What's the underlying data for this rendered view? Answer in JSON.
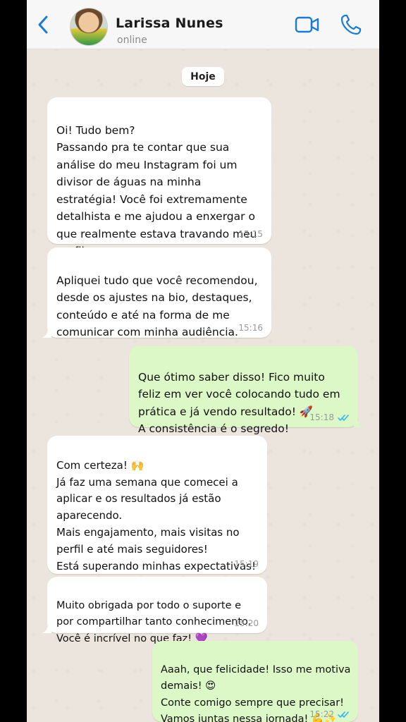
{
  "header": {
    "contact_name": "Larissa Nunes",
    "status": "online",
    "accent_color": "#1a7bd6",
    "icons": [
      "back-chevron-icon",
      "video-camera-icon",
      "phone-icon"
    ]
  },
  "chat": {
    "day_label": "Hoje",
    "messages": [
      {
        "direction": "in",
        "text": "Oi! Tudo bem?\nPassando pra te contar que sua análise do meu Instagram foi um divisor de águas na minha estratégia! Você foi extremamente detalhista e me ajudou a enxergar o que realmente estava travando meu perfil.",
        "time": "15:15"
      },
      {
        "direction": "in",
        "text": "Apliquei tudo que você recomendou, desde os ajustes na bio, destaques, conteúdo e até na forma de me comunicar com minha audiência.",
        "time": "15:16"
      },
      {
        "direction": "out",
        "text": "Que ótimo saber disso! Fico muito feliz em ver você colocando tudo em prática e já vendo resultado! 🚀\nA consistência é o segredo!",
        "time": "15:18",
        "read": true
      },
      {
        "direction": "in",
        "text": "Com certeza! 🙌\nJá faz uma semana que comecei a aplicar e os resultados já estão aparecendo.\nMais engajamento, mais visitas no perfil e até mais seguidores!\nEstá superando minhas expectativas!",
        "time": "15:19"
      },
      {
        "direction": "in",
        "text": "Muito obrigada por todo o suporte e por compartilhar tanto conhecimento. Você é incrível no que faz! 💜",
        "time": "15:20"
      },
      {
        "direction": "out",
        "text": "Aaah, que felicidade! Isso me motiva demais! 😍\nConte comigo sempre que precisar!\nVamos juntas nessa jornada! 💪✨",
        "time": "15:22",
        "read": true
      }
    ]
  },
  "colors": {
    "incoming_bubble": "#ffffff",
    "outgoing_bubble": "#dcf8c6",
    "chat_background": "#ece5dd",
    "read_ticks": "#34b7f1"
  }
}
